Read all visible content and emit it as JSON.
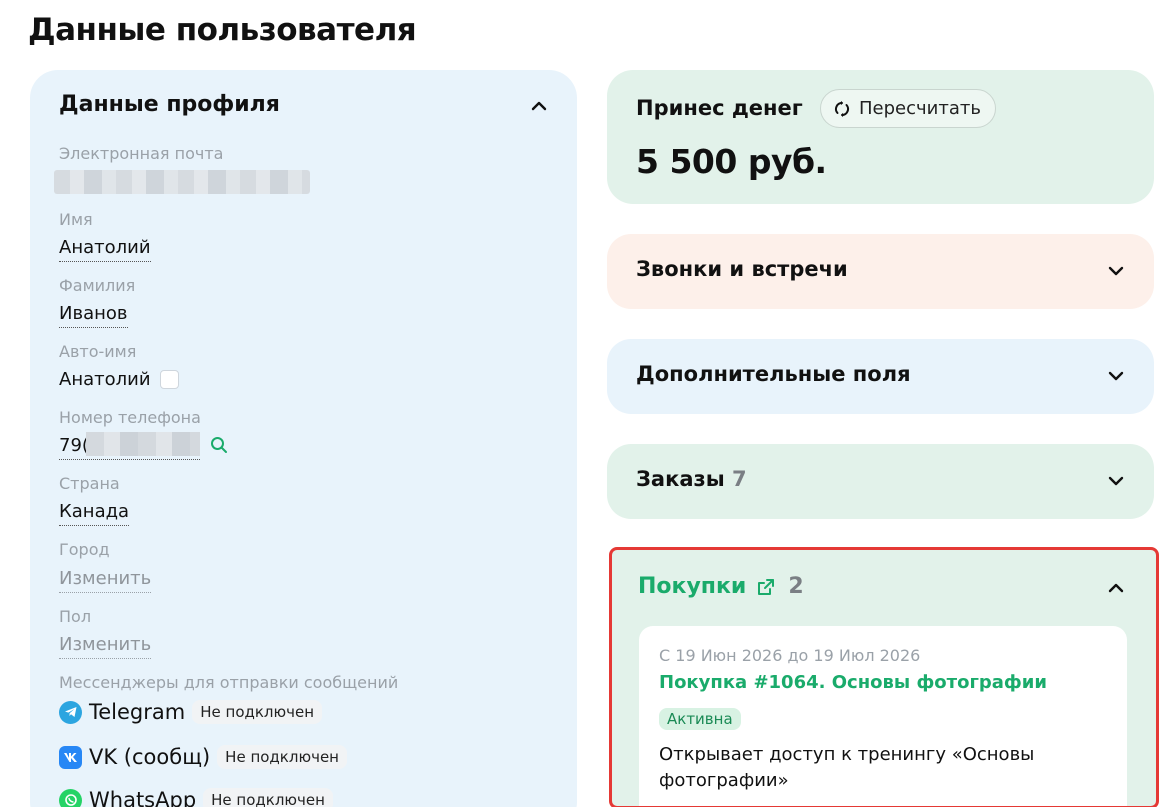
{
  "page": {
    "title": "Данные пользователя"
  },
  "profile": {
    "heading": "Данные профиля",
    "fields": {
      "email_label": "Электронная почта",
      "name_label": "Имя",
      "name_value": "Анатолий",
      "surname_label": "Фамилия",
      "surname_value": "Иванов",
      "autoname_label": "Авто-имя",
      "autoname_value": "Анатолий",
      "phone_label": "Номер телефона",
      "phone_value": "79(",
      "country_label": "Страна",
      "country_value": "Канада",
      "city_label": "Город",
      "city_value": "Изменить",
      "gender_label": "Пол",
      "gender_value": "Изменить",
      "messengers_label": "Мессенджеры для отправки сообщений"
    },
    "messengers": [
      {
        "name": "Telegram",
        "status": "Не подключен",
        "icon": "telegram-icon",
        "color": "#2ca5e0"
      },
      {
        "name": "VK (сообщ)",
        "status": "Не подключен",
        "icon": "vk-icon",
        "color": "#2787f5"
      },
      {
        "name": "WhatsApp",
        "status": "Не подключен",
        "icon": "whatsapp-icon",
        "color": "#25d366"
      }
    ]
  },
  "money": {
    "title": "Принес денег",
    "recalc_label": "Пересчитать",
    "amount": "5 500 руб."
  },
  "sections": {
    "calls": {
      "title": "Звонки и встречи",
      "bg": "#fdf0ea"
    },
    "extra_fields": {
      "title": "Дополнительные поля",
      "bg": "#e8f3fb"
    },
    "orders": {
      "title": "Заказы",
      "count": "7",
      "bg": "#e2f2ea"
    }
  },
  "purchases": {
    "title": "Покупки",
    "count": "2",
    "item": {
      "dates": "С 19 Июн 2026 до 19 Июл 2026",
      "link": "Покупка #1064. Основы фотографии",
      "status": "Активна",
      "description": "Открывает доступ к тренингу «Основы фотографии»"
    }
  },
  "colors": {
    "accent_green": "#1aab6b",
    "highlight_border": "#e53935"
  }
}
